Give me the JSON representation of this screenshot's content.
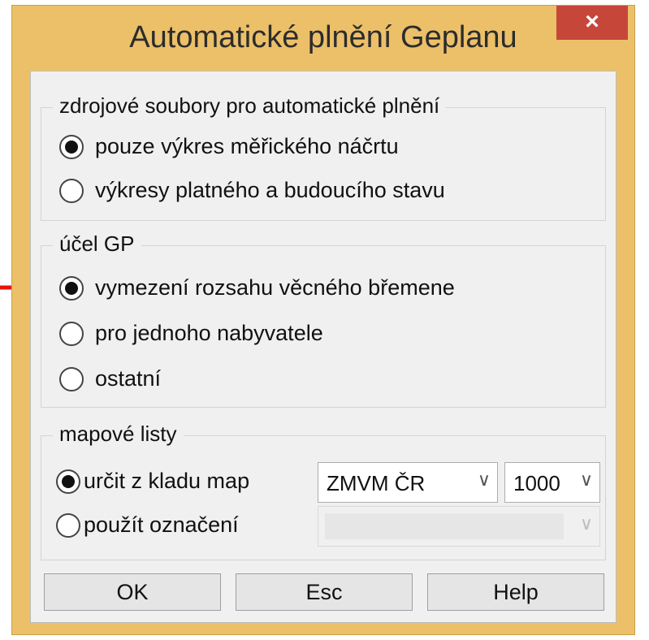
{
  "window": {
    "title": "Automatické plnění Geplanu",
    "close_glyph": "×"
  },
  "group_sources": {
    "legend": "zdrojové soubory pro automatické plnění",
    "options": [
      {
        "label": "pouze výkres měřického náčrtu",
        "selected": true
      },
      {
        "label": "výkresy platného a budoucího stavu",
        "selected": false
      }
    ]
  },
  "group_purpose": {
    "legend": "účel GP",
    "options": [
      {
        "label": "vymezení rozsahu věcného břemene",
        "selected": true
      },
      {
        "label": "pro jednoho nabyvatele",
        "selected": false
      },
      {
        "label": "ostatní",
        "selected": false
      }
    ]
  },
  "group_sheets": {
    "legend": "mapové listy",
    "options": [
      {
        "label": "určit z kladu map",
        "selected": true
      },
      {
        "label": "použít označení",
        "selected": false
      }
    ],
    "map_system": "ZMVM ČR",
    "scale": "1000",
    "designation": ""
  },
  "buttons": {
    "ok": "OK",
    "esc": "Esc",
    "help": "Help"
  },
  "annotation_color": "#e8140c",
  "icons": [
    "close-icon",
    "chevron-down-icon",
    "red-arrow-annotation"
  ]
}
